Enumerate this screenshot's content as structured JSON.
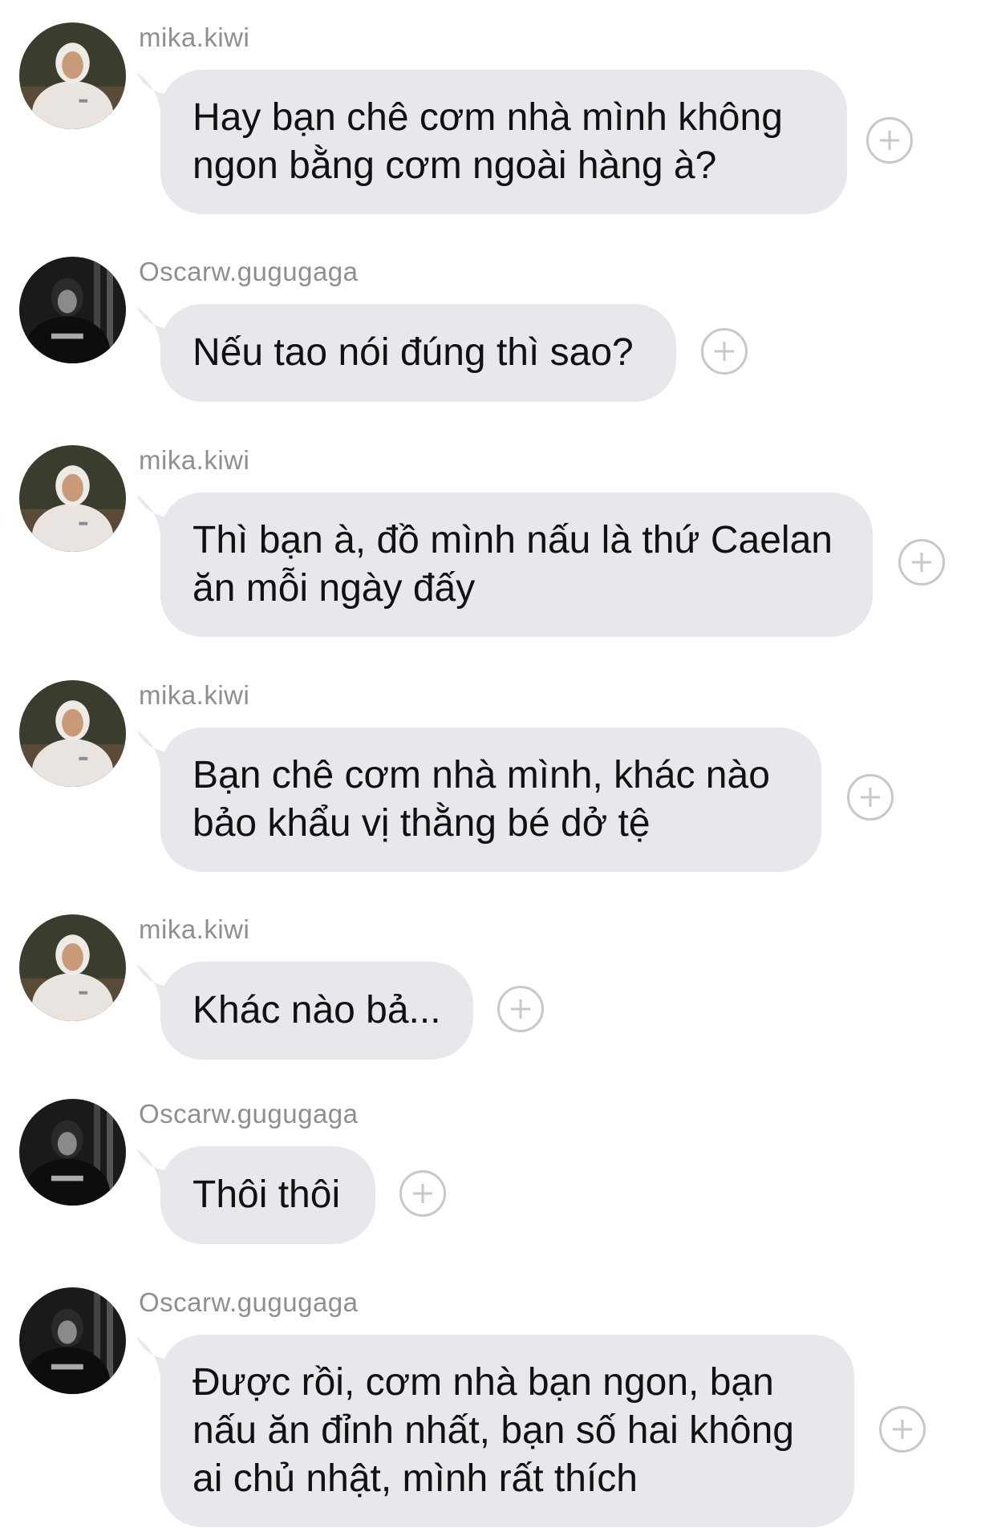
{
  "messages": [
    {
      "sender": "mika.kiwi",
      "avatar": "mika-avatar",
      "lines": [
        "Hay bạn chê cơm nhà mình không",
        "ngon bằng cơm ngoài hàng à?"
      ]
    },
    {
      "sender": "Oscarw.gugugaga",
      "avatar": "oscar-avatar",
      "lines": [
        "Nếu tao nói đúng thì sao?"
      ]
    },
    {
      "sender": "mika.kiwi",
      "avatar": "mika-avatar",
      "lines": [
        "Thì bạn à, đồ mình nấu là thứ Caelan",
        "ăn mỗi ngày đấy"
      ]
    },
    {
      "sender": "mika.kiwi",
      "avatar": "mika-avatar",
      "lines": [
        "Bạn chê cơm nhà mình, khác nào",
        "bảo khẩu vị thằng bé dở tệ"
      ]
    },
    {
      "sender": "mika.kiwi",
      "avatar": "mika-avatar",
      "lines": [
        "Khác nào bả..."
      ]
    },
    {
      "sender": "Oscarw.gugugaga",
      "avatar": "oscar-avatar",
      "lines": [
        "Thôi thôi"
      ]
    },
    {
      "sender": "Oscarw.gugugaga",
      "avatar": "oscar-avatar",
      "lines": [
        "Được rồi, cơm nhà bạn ngon, bạn",
        "nấu ăn đỉnh nhất, bạn số hai không",
        "ai chủ nhật, mình rất thích"
      ]
    }
  ],
  "icons": {
    "react": "add-reaction-icon"
  },
  "colors": {
    "bubble": "#e6e8ec",
    "username": "#8e8e93",
    "text": "#111111",
    "react_border": "#c7c7cc"
  }
}
